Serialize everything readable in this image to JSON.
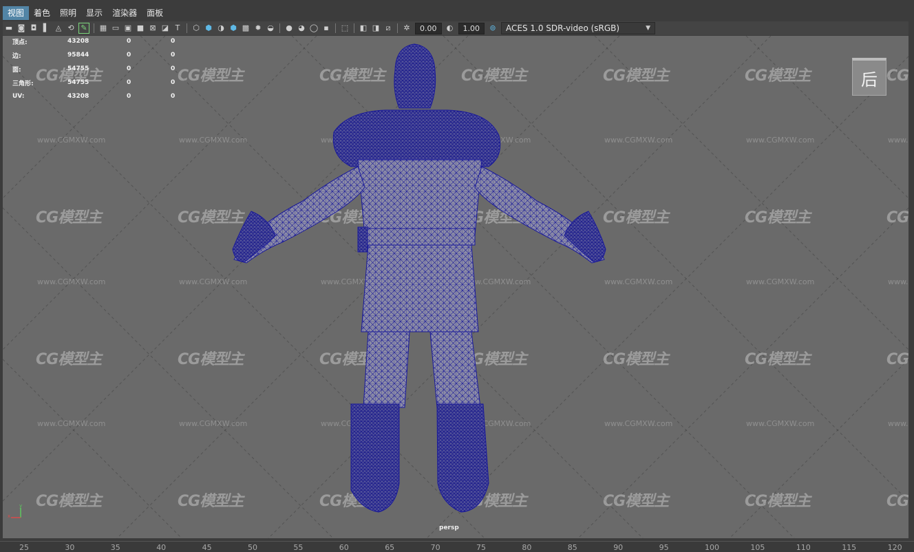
{
  "menubar": {
    "items": [
      "视图",
      "着色",
      "照明",
      "显示",
      "渲染器",
      "面板"
    ],
    "active_index": 0
  },
  "toolbar": {
    "exposure_value": "0.00",
    "gamma_value": "1.00",
    "color_management": "ACES 1.0 SDR-video (sRGB)"
  },
  "heads_up": {
    "rows": [
      {
        "label": "顶点:",
        "v1": "43208",
        "v2": "0",
        "v3": "0"
      },
      {
        "label": "边:",
        "v1": "95844",
        "v2": "0",
        "v3": "0"
      },
      {
        "label": "面:",
        "v1": "54755",
        "v2": "0",
        "v3": "0"
      },
      {
        "label": "三角形:",
        "v1": "54755",
        "v2": "0",
        "v3": "0"
      },
      {
        "label": "UV:",
        "v1": "43208",
        "v2": "0",
        "v3": "0"
      }
    ]
  },
  "viewcube": {
    "face_label": "后"
  },
  "camera_label": "persp",
  "watermark": {
    "logo": "CG模型主",
    "url": "www.CGMXW.com"
  },
  "axis": {
    "y": "y",
    "x": "x"
  },
  "ruler": {
    "ticks": [
      "25",
      "30",
      "35",
      "40",
      "45",
      "50",
      "55",
      "60",
      "65",
      "70",
      "75",
      "80",
      "85",
      "90",
      "95",
      "100",
      "105",
      "110",
      "115",
      "120"
    ]
  },
  "colors": {
    "wire": "#1a1a9a",
    "mesh_fill": "#8a8aa4",
    "viewport_bg": "#6a6a6a",
    "active_menu": "#5285a6"
  }
}
